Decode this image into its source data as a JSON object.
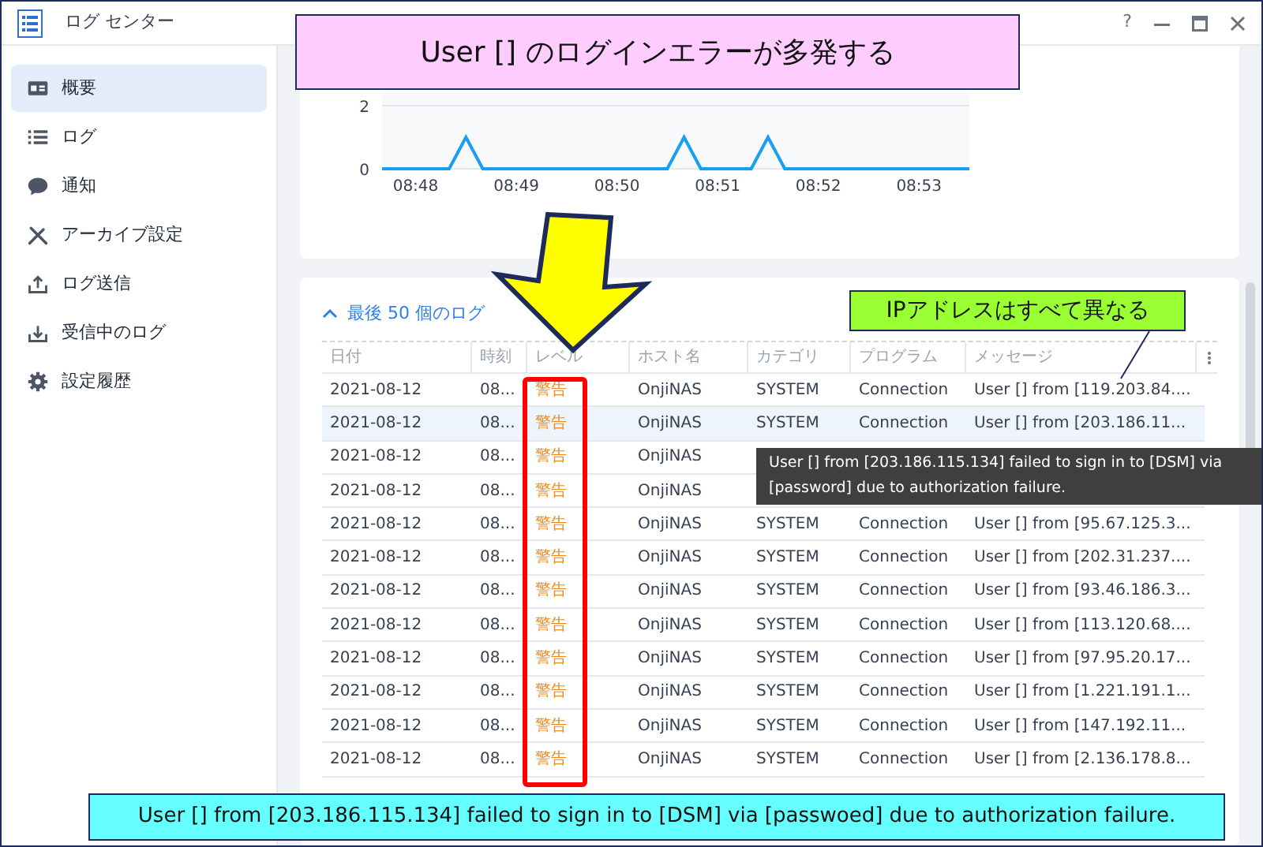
{
  "window": {
    "title": "ログ センター",
    "controls": [
      "?"
    ]
  },
  "sidebar": {
    "items": [
      {
        "label": "概要",
        "selected": true
      },
      {
        "label": "ログ",
        "selected": false
      },
      {
        "label": "通知",
        "selected": false
      },
      {
        "label": "アーカイブ設定",
        "selected": false
      },
      {
        "label": "ログ送信",
        "selected": false
      },
      {
        "label": "受信中のログ",
        "selected": false
      },
      {
        "label": "設定履歴",
        "selected": false
      }
    ]
  },
  "chart": {
    "chart_data": {
      "type": "line",
      "categories": [
        null,
        null,
        "08:48",
        null,
        null,
        null,
        null,
        null,
        "08:49",
        null,
        null,
        null,
        null,
        null,
        "08:50",
        null,
        null,
        null,
        null,
        null,
        "08:51",
        null,
        null,
        null,
        null,
        null,
        "08:52",
        null,
        null,
        null,
        null,
        null,
        "08:53",
        null,
        null,
        null
      ],
      "series": [
        {
          "color": "#1a9ff0",
          "values": [
            0,
            0,
            0,
            0,
            0,
            1,
            0,
            0,
            0,
            0,
            0,
            0,
            0,
            0,
            0,
            0,
            0,
            0,
            1,
            0,
            0,
            0,
            0,
            1,
            0,
            0,
            0,
            0,
            0,
            0,
            0,
            0,
            0,
            0,
            0,
            0
          ]
        }
      ],
      "ylim": [
        0,
        2.4
      ],
      "yticks": [
        0,
        2
      ]
    }
  },
  "log_table": {
    "title": "最後 50 個のログ",
    "expanded": true,
    "columns": [
      "日付",
      "時刻",
      "レベル",
      "ホスト名",
      "カテゴリ",
      "プログラム",
      "メッセージ"
    ],
    "rows": [
      {
        "date": "2021-08-12",
        "time": "08...",
        "level": "警告",
        "host": "OnjiNAS",
        "category": "SYSTEM",
        "program": "Connection",
        "message": "User [] from [119.203.84....",
        "selected": false
      },
      {
        "date": "2021-08-12",
        "time": "08...",
        "level": "警告",
        "host": "OnjiNAS",
        "category": "SYSTEM",
        "program": "Connection",
        "message": "User [] from [203.186.11...",
        "selected": true
      },
      {
        "date": "2021-08-12",
        "time": "08...",
        "level": "警告",
        "host": "OnjiNAS",
        "selected": false
      },
      {
        "date": "2021-08-12",
        "time": "08...",
        "level": "警告",
        "host": "OnjiNAS",
        "selected": false
      },
      {
        "date": "2021-08-12",
        "time": "08...",
        "level": "警告",
        "host": "OnjiNAS",
        "category": "SYSTEM",
        "program": "Connection",
        "message": "User [] from [95.67.125.3...",
        "selected": false
      },
      {
        "date": "2021-08-12",
        "time": "08...",
        "level": "警告",
        "host": "OnjiNAS",
        "category": "SYSTEM",
        "program": "Connection",
        "message": "User [] from [202.31.237....",
        "selected": false
      },
      {
        "date": "2021-08-12",
        "time": "08...",
        "level": "警告",
        "host": "OnjiNAS",
        "category": "SYSTEM",
        "program": "Connection",
        "message": "User [] from [93.46.186.3...",
        "selected": false
      },
      {
        "date": "2021-08-12",
        "time": "08...",
        "level": "警告",
        "host": "OnjiNAS",
        "category": "SYSTEM",
        "program": "Connection",
        "message": "User [] from [113.120.68....",
        "selected": false
      },
      {
        "date": "2021-08-12",
        "time": "08...",
        "level": "警告",
        "host": "OnjiNAS",
        "category": "SYSTEM",
        "program": "Connection",
        "message": "User [] from [97.95.20.17...",
        "selected": false
      },
      {
        "date": "2021-08-12",
        "time": "08...",
        "level": "警告",
        "host": "OnjiNAS",
        "category": "SYSTEM",
        "program": "Connection",
        "message": "User [] from [1.221.191.1...",
        "selected": false
      },
      {
        "date": "2021-08-12",
        "time": "08...",
        "level": "警告",
        "host": "OnjiNAS",
        "category": "SYSTEM",
        "program": "Connection",
        "message": "User [] from [147.192.11...",
        "selected": false
      },
      {
        "date": "2021-08-12",
        "time": "08...",
        "level": "警告",
        "host": "OnjiNAS",
        "category": "SYSTEM",
        "program": "Connection",
        "message": "User [] from [2.136.178.8...",
        "selected": false
      }
    ]
  },
  "tooltip": "User [] from [203.186.115.134] failed to sign in to [DSM] via [password] due to authorization failure.",
  "callouts": [
    {
      "kind": "title",
      "text": "User [] のログインエラーが多発する"
    },
    {
      "kind": "note",
      "text": "IPアドレスはすべて異なる"
    },
    {
      "kind": "caption",
      "text": "User [] from [203.186.115.134] failed to sign in to [DSM] via [passwoed] due to authorization failure."
    }
  ]
}
